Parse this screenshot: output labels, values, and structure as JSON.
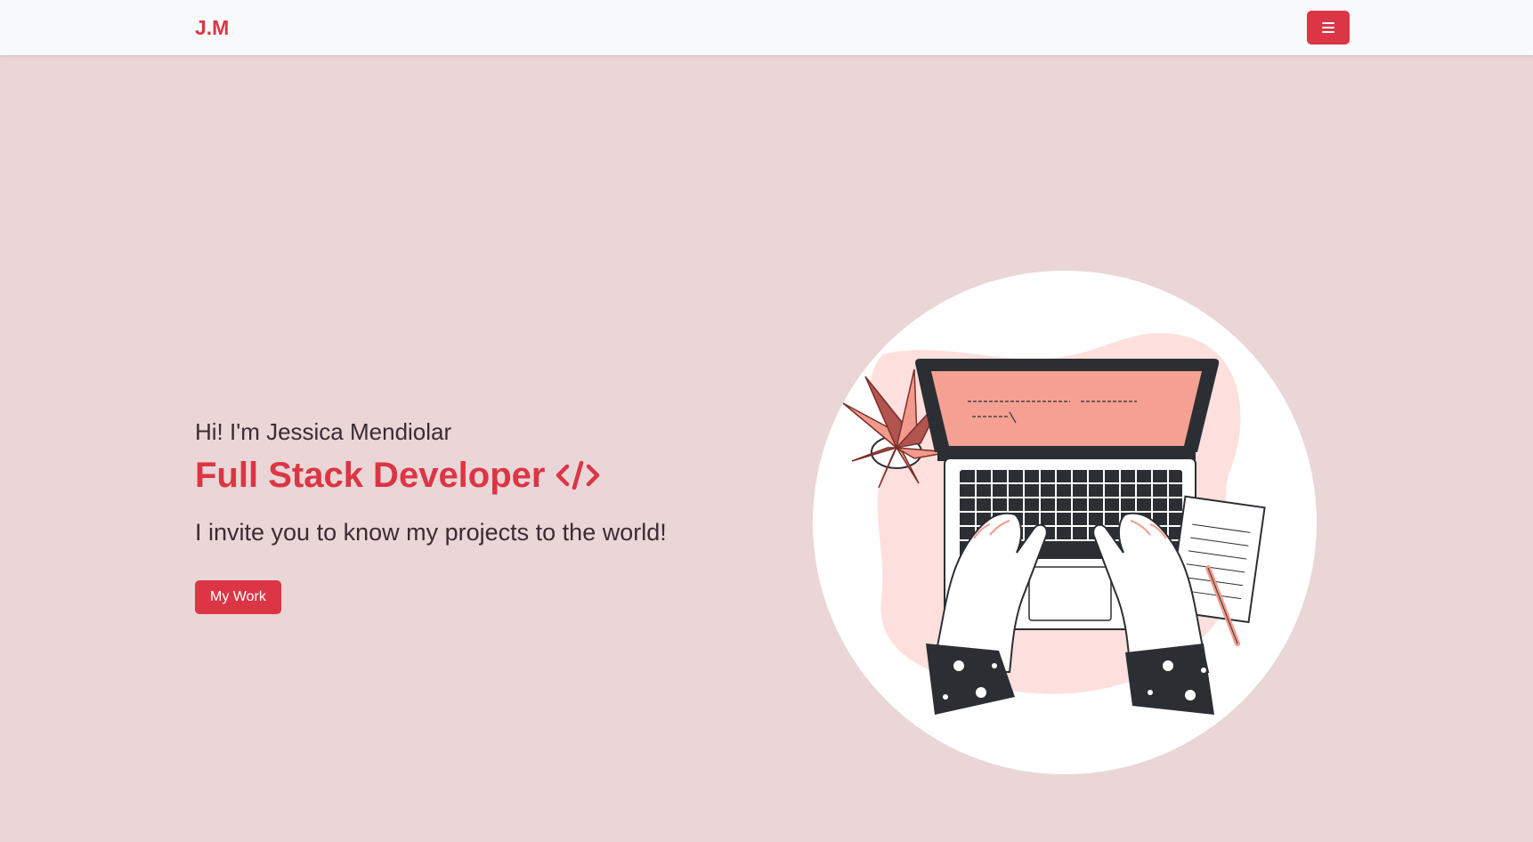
{
  "nav": {
    "brand": "J.M",
    "menu_icon": "hamburger-menu-icon"
  },
  "hero": {
    "greeting": "Hi! I'm Jessica Mendiolar",
    "title": "Full Stack Developer",
    "title_icon": "code-brackets-icon",
    "tagline": "I invite you to know my projects to the world!",
    "cta_label": "My Work",
    "illustration": "laptop-typing-illustration"
  },
  "colors": {
    "accent": "#dc3545",
    "background": "#ead6d6",
    "navbar": "#f8f9fa",
    "screen": "#f5a092",
    "dark": "#2b2f33"
  }
}
